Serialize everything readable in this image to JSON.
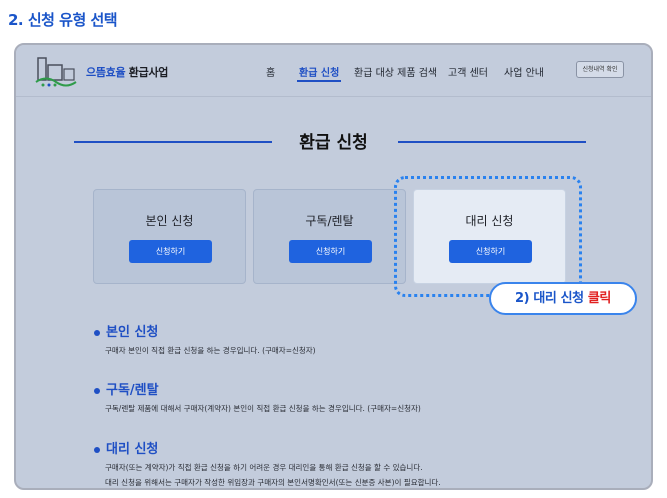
{
  "step_title": "2. 신청 유형 선택",
  "header": {
    "brand_highlight": "으뜸효율",
    "brand_rest": " 환급사업",
    "nav": [
      "홈",
      "환급 신청",
      "환급 대상 제품 검색",
      "고객 센터",
      "사업 안내"
    ],
    "active_nav": "환급 신청",
    "status_button": "신청내역 확인"
  },
  "page_heading": "환급 신청",
  "cards": [
    {
      "title": "본인 신청",
      "button": "신청하기",
      "selected": false
    },
    {
      "title": "구독/렌탈",
      "button": "신청하기",
      "selected": false
    },
    {
      "title": "대리 신청",
      "button": "신청하기",
      "selected": true
    }
  ],
  "callout": {
    "prefix": "2) 대리 신청 ",
    "action": "클릭"
  },
  "sections": [
    {
      "title": "본인 신청",
      "lines": [
        "구매자 본인이 직접 환급 신청을 하는 경우입니다. (구매자=신청자)"
      ]
    },
    {
      "title": "구독/렌탈",
      "lines": [
        "구독/렌탈 제품에 대해서 구매자(계약자) 본인이 직접 환급 신청을 하는 경우입니다. (구매자=신청자)"
      ]
    },
    {
      "title": "대리 신청",
      "lines": [
        "구매자(또는 계약자)가 직접 환급 신청을 하기 어려운 경우 대리인을 통해 환급 신청을 할 수 있습니다.",
        "대리 신청을 위해서는 구매자가 작성한 위임장과 구매자의 본인서명확인서(또는 신분증 사본)이 필요합니다."
      ]
    }
  ],
  "colors": {
    "primary": "#1f4fc4",
    "button": "#1f63df",
    "highlight": "#2a82ef",
    "accent_red": "#e12020",
    "frame_bg": "#c3ccdc"
  }
}
